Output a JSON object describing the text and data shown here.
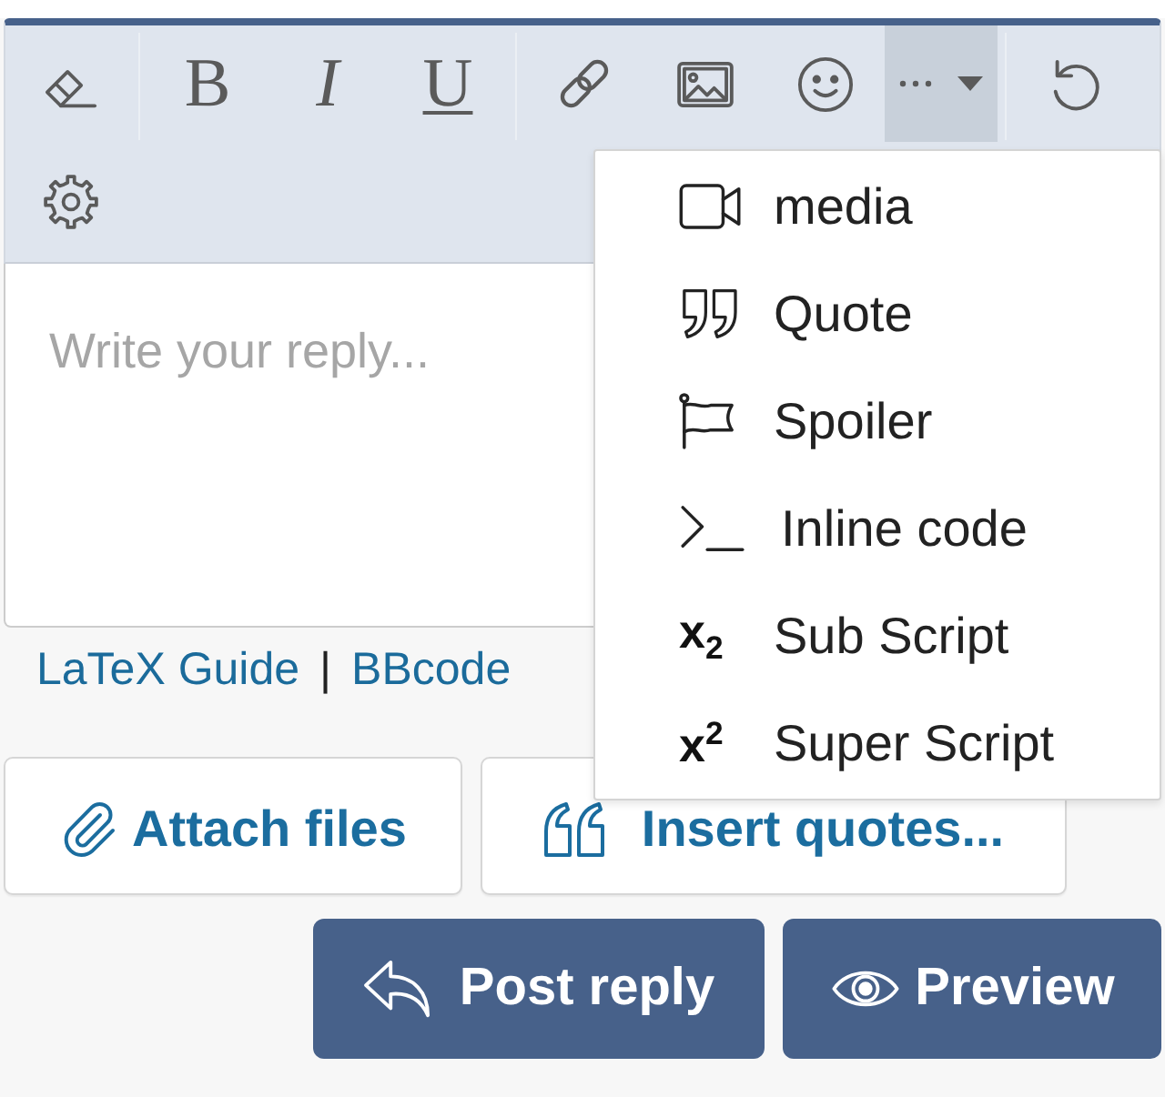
{
  "toolbar": {
    "rows": [
      [
        [
          {
            "kind": "clear"
          }
        ],
        [
          {
            "kind": "bold",
            "label": "B"
          },
          {
            "kind": "italic",
            "label": "I"
          },
          {
            "kind": "underline",
            "label": "U"
          }
        ],
        [
          {
            "kind": "link"
          },
          {
            "kind": "image"
          },
          {
            "kind": "emoji"
          },
          {
            "kind": "more",
            "expanded": true
          }
        ],
        [
          {
            "kind": "undo"
          }
        ]
      ],
      [
        [
          {
            "kind": "options"
          }
        ]
      ]
    ]
  },
  "editor": {
    "placeholder": "Write your reply..."
  },
  "help_links": {
    "links": [
      "LaTeX Guide",
      "BBcode"
    ],
    "separator": "|"
  },
  "attach_buttons": [
    {
      "kind": "attach",
      "label": "Attach files"
    },
    {
      "kind": "quotes",
      "label": "Insert quotes..."
    }
  ],
  "action_buttons": [
    {
      "kind": "reply",
      "label": "Post reply"
    },
    {
      "kind": "preview",
      "label": "Preview"
    }
  ],
  "more_menu": {
    "items": [
      {
        "kind": "media",
        "label": "media"
      },
      {
        "kind": "quote",
        "label": "Quote"
      },
      {
        "kind": "spoiler",
        "label": "Spoiler"
      },
      {
        "kind": "code",
        "label": "Inline code"
      },
      {
        "kind": "subscript",
        "symbol": "x$_{2}$",
        "label": "Sub Script"
      },
      {
        "kind": "superscript",
        "symbol": "x$^{2}$",
        "label": "Super Script"
      }
    ]
  }
}
